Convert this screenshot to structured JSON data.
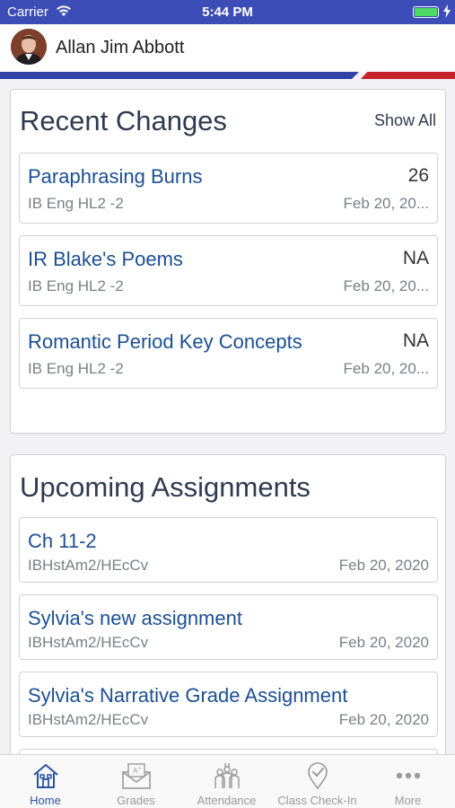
{
  "status_bar": {
    "carrier": "Carrier",
    "time": "5:44 PM"
  },
  "user": {
    "name": "Allan Jim Abbott"
  },
  "recent_changes": {
    "title": "Recent Changes",
    "show_all": "Show All",
    "items": [
      {
        "title": "Paraphrasing Burns",
        "value": "26",
        "course": "IB Eng HL2 -2",
        "date": "Feb 20, 20..."
      },
      {
        "title": "IR Blake's Poems",
        "value": "NA",
        "course": "IB Eng HL2 -2",
        "date": "Feb 20, 20..."
      },
      {
        "title": "Romantic Period Key Concepts",
        "value": "NA",
        "course": "IB Eng HL2 -2",
        "date": "Feb 20, 20..."
      }
    ]
  },
  "upcoming_assignments": {
    "title": "Upcoming Assignments",
    "items": [
      {
        "title": "Ch 11-2",
        "course": "IBHstAm2/HEcCv",
        "date": "Feb 20, 2020"
      },
      {
        "title": "Sylvia's new assignment",
        "course": "IBHstAm2/HEcCv",
        "date": "Feb 20, 2020"
      },
      {
        "title": "Sylvia's Narrative Grade Assignment",
        "course": "IBHstAm2/HEcCv",
        "date": "Feb 20, 2020"
      }
    ]
  },
  "tabs": [
    {
      "label": "Home",
      "icon": "home-icon",
      "active": true
    },
    {
      "label": "Grades",
      "icon": "grades-icon",
      "active": false
    },
    {
      "label": "Attendance",
      "icon": "attendance-icon",
      "active": false
    },
    {
      "label": "Class Check-In",
      "icon": "check-in-icon",
      "active": false
    },
    {
      "label": "More",
      "icon": "more-icon",
      "active": false
    }
  ],
  "colors": {
    "status_bar": "#3c4db8",
    "accent_blue": "#1b4f93",
    "stripe_blue": "#3142a7",
    "stripe_red": "#c8232c",
    "active_tab": "#2952a3"
  }
}
